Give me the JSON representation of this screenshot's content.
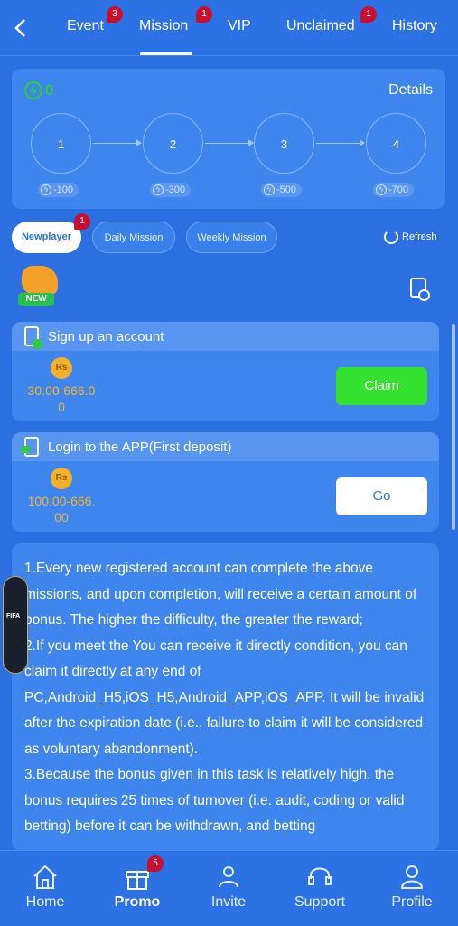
{
  "header": {
    "tabs": [
      {
        "label": "Event",
        "badge": "3"
      },
      {
        "label": "Mission",
        "badge": "1"
      },
      {
        "label": "VIP",
        "badge": ""
      },
      {
        "label": "Unclaimed",
        "badge": "1"
      },
      {
        "label": "History",
        "badge": ""
      }
    ],
    "active_tab": "Mission"
  },
  "progress": {
    "energy_count": "0",
    "details_label": "Details",
    "steps": [
      {
        "number": "1",
        "reward": "-100"
      },
      {
        "number": "2",
        "reward": "-300"
      },
      {
        "number": "3",
        "reward": "-500"
      },
      {
        "number": "4",
        "reward": "-700"
      }
    ]
  },
  "filters": {
    "pills": [
      {
        "label": "Newplayer",
        "badge": "1"
      },
      {
        "label": "Daily Mission"
      },
      {
        "label": "Weekly Mission"
      }
    ],
    "active": "Newplayer",
    "refresh_label": "Refresh"
  },
  "new_badge_label": "NEW",
  "tasks": [
    {
      "title": "Sign up an account",
      "coin": "Rs",
      "reward_line1": "30.00-666.0",
      "reward_line2": "0",
      "button": "Claim"
    },
    {
      "title": "Login to the APP(First deposit)",
      "coin": "Rs",
      "reward_line1": "100.00-666.",
      "reward_line2": "00",
      "button": "Go"
    }
  ],
  "rules_text": "1.Every new registered account can complete the above missions, and upon completion, will receive a certain amount of bonus. The higher the difficulty, the greater the reward;\n2.If you meet the You can receive it directly condition, you can claim it directly at any end of PC,Android_H5,iOS_H5,Android_APP,iOS_APP. It will be invalid after the expiration date (i.e., failure to claim it will be considered as voluntary abandonment).\n3.Because the bonus given in this task is relatively high, the bonus requires 25 times of turnover (i.e. audit, coding or valid betting) before it can be withdrawn, and betting",
  "floating_banner": {
    "text": "FIFA"
  },
  "bottom_nav": {
    "items": [
      {
        "label": "Home"
      },
      {
        "label": "Promo",
        "badge": "5"
      },
      {
        "label": "Invite"
      },
      {
        "label": "Support"
      },
      {
        "label": "Profile"
      }
    ],
    "active": "Promo"
  },
  "colors": {
    "background": "#2b6fe0",
    "card": "#3e85ee",
    "claim_button": "#33e12e",
    "coin_text": "#f5b430",
    "badge": "#c8102e"
  }
}
